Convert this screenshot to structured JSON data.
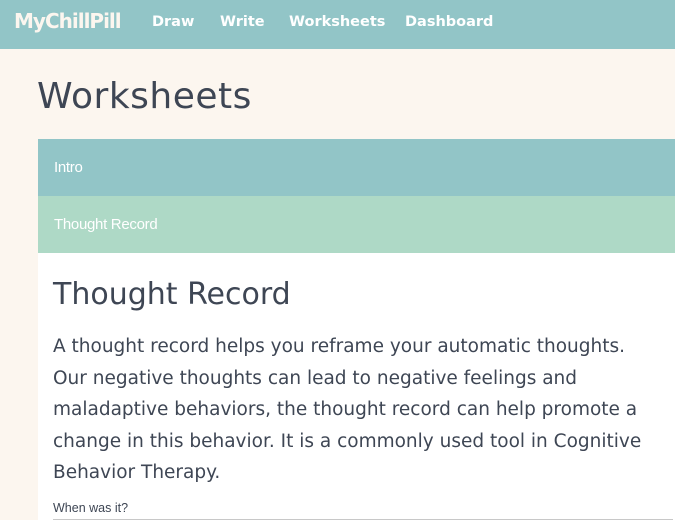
{
  "navbar": {
    "brand": "MyChillPill",
    "links": [
      "Draw",
      "Write",
      "Worksheets",
      "Dashboard"
    ]
  },
  "page": {
    "title": "Worksheets"
  },
  "accordion": {
    "sections": [
      "Intro",
      "Thought Record"
    ]
  },
  "worksheet": {
    "title": "Thought Record",
    "description": "A thought record helps you reframe your automatic thoughts. Our negative thoughts can lead to negative feelings and maladaptive behaviors, the thought record can help promote a change in this behavior. It is a commonly used tool in Cognitive Behavior Therapy.",
    "fields": [
      {
        "label": "When was it?"
      }
    ]
  },
  "colors": {
    "nav_bg": "#92c5c7",
    "page_bg": "#fcf6ef",
    "intro_bg": "#92c5c7",
    "active_section_bg": "#aed9c6",
    "text": "#3e4654"
  }
}
